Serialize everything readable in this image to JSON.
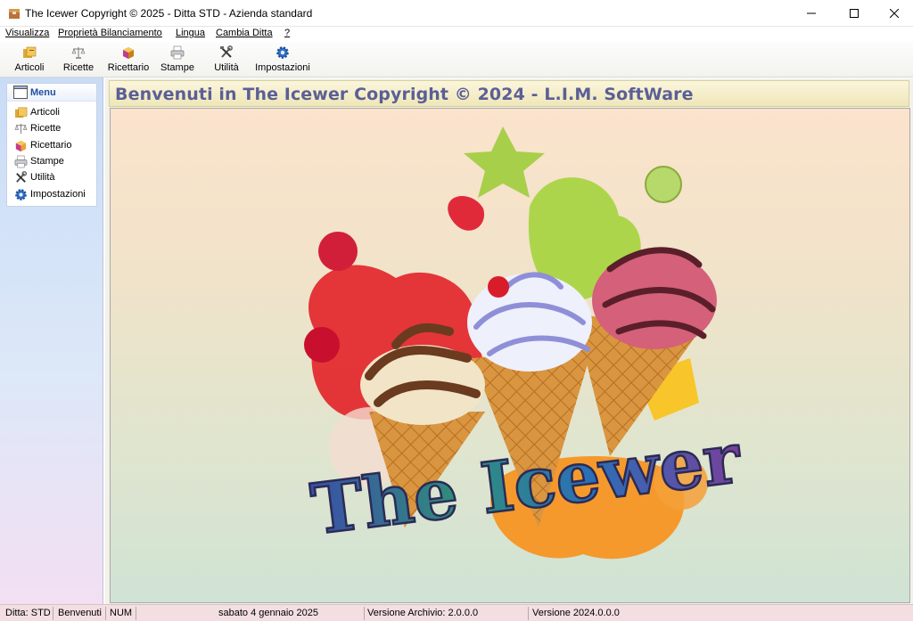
{
  "window": {
    "title": "The Icewer Copyright © 2025 - Ditta STD - Azienda standard"
  },
  "menubar": [
    "Visualizza",
    "Proprietà Bilanciamento",
    "Lingua",
    "Cambia Ditta",
    "?"
  ],
  "toolbar": [
    {
      "label": "Articoli",
      "icon": "articoli-icon"
    },
    {
      "label": "Ricette",
      "icon": "scale-icon"
    },
    {
      "label": "Ricettario",
      "icon": "box-icon"
    },
    {
      "label": "Stampe",
      "icon": "printer-icon"
    },
    {
      "label": "Utilità",
      "icon": "tools-icon"
    },
    {
      "label": "Impostazioni",
      "icon": "gear-icon"
    }
  ],
  "sidebar": {
    "title": "Menu",
    "items": [
      "Articoli",
      "Ricette",
      "Ricettario",
      "Stampe",
      "Utilità",
      "Impostazioni"
    ]
  },
  "main": {
    "welcome": "Benvenuti in The Icewer Copyright © 2024 - L.I.M. SoftWare",
    "logo_text": "The Icewer"
  },
  "status": {
    "ditta": "Ditta: STD",
    "page": "Benvenuti",
    "num": "NUM",
    "date": "sabato 4 gennaio 2025",
    "archive": "Versione Archivio: 2.0.0.0",
    "version": "Versione 2024.0.0.0"
  },
  "colors": {
    "title_text": "#5b5f96",
    "menu_title": "#1f4fa0",
    "sidebar_top": "#c9dcf7",
    "status_bg": "#f3dfe2"
  }
}
